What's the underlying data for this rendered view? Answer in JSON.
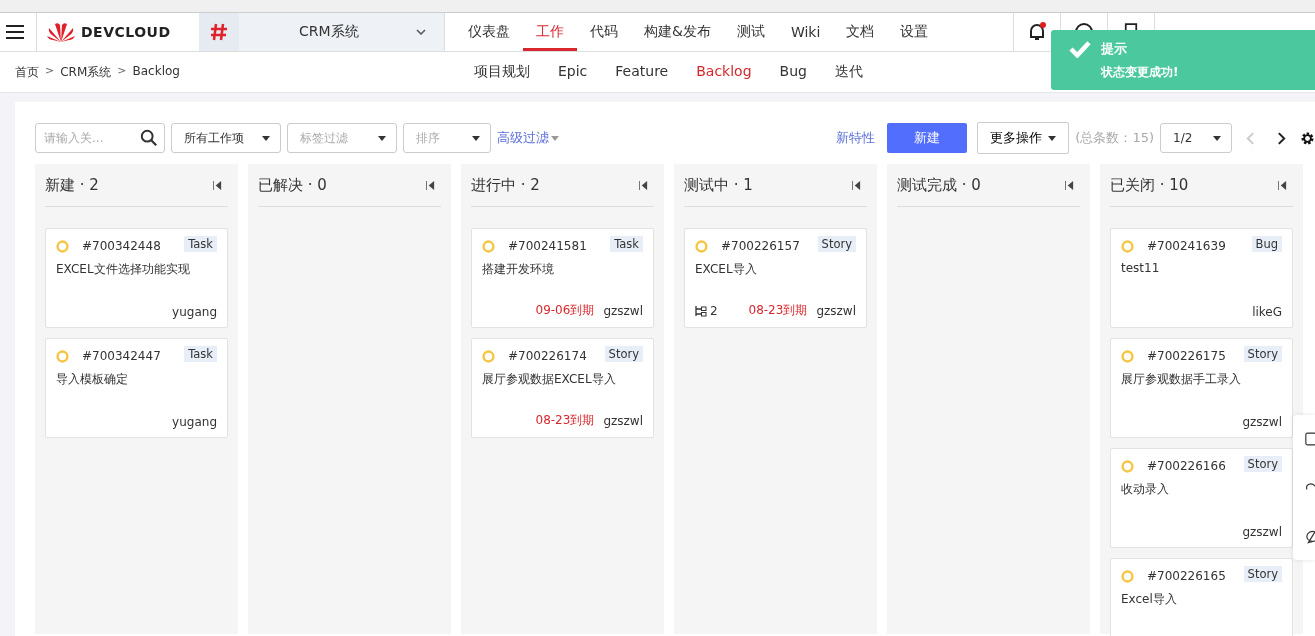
{
  "header": {
    "logo": "DEVCLOUD",
    "project": "CRM系统",
    "nav": [
      {
        "label": "仪表盘",
        "selected": false
      },
      {
        "label": "工作",
        "selected": true
      },
      {
        "label": "代码",
        "selected": false
      },
      {
        "label": "构建&发布",
        "selected": false
      },
      {
        "label": "测试",
        "selected": false
      },
      {
        "label": "Wiki",
        "selected": false
      },
      {
        "label": "文档",
        "selected": false
      },
      {
        "label": "设置",
        "selected": false
      }
    ]
  },
  "breadcrumb": [
    "首页",
    ">",
    "CRM系统",
    ">",
    "Backlog"
  ],
  "subnav": [
    {
      "label": "项目规划",
      "selected": false
    },
    {
      "label": "Epic",
      "selected": false
    },
    {
      "label": "Feature",
      "selected": false
    },
    {
      "label": "Backlog",
      "selected": true
    },
    {
      "label": "Bug",
      "selected": false
    },
    {
      "label": "迭代",
      "selected": false
    }
  ],
  "toast": {
    "title": "提示",
    "message": "状态变更成功!"
  },
  "toolbar": {
    "search": {
      "placeholder": "请输入关..."
    },
    "type_filter": "所有工作项",
    "tag_filter": {
      "placeholder": "标签过滤"
    },
    "sort": {
      "placeholder": "排序"
    },
    "advanced": "高级过滤",
    "new_feature": "新特性",
    "create": "新建",
    "more": "更多操作",
    "total": "(总条数：15)",
    "page": "1/2"
  },
  "columns": [
    {
      "title": "新建 · 2",
      "cards": [
        {
          "id": "#700342448",
          "type": "Task",
          "title": "EXCEL文件选择功能实现",
          "assignee": "yugang"
        },
        {
          "id": "#700342447",
          "type": "Task",
          "title": "导入模板确定",
          "assignee": "yugang"
        }
      ]
    },
    {
      "title": "已解决 · 0"
    },
    {
      "title": "进行中 · 2",
      "cards": [
        {
          "id": "#700241581",
          "type": "Task",
          "title": "搭建开发环境",
          "due": "09-06到期",
          "assignee": "gzszwl"
        },
        {
          "id": "#700226174",
          "type": "Story",
          "title": "展厅参观数据EXCEL导入",
          "due": "08-23到期",
          "assignee": "gzszwl"
        }
      ]
    },
    {
      "title": "测试中 · 1",
      "cards": [
        {
          "id": "#700226157",
          "type": "Story",
          "title": "EXCEL导入",
          "children": "2",
          "due": "08-23到期",
          "assignee": "gzszwl"
        }
      ]
    },
    {
      "title": "测试完成 · 0"
    },
    {
      "title": "已关闭 · 10",
      "cards": [
        {
          "id": "#700241639",
          "type": "Bug",
          "title": "test11",
          "assignee": "likeG"
        },
        {
          "id": "#700226175",
          "type": "Story",
          "title": "展厅参观数据手工录入",
          "assignee": "gzszwl"
        },
        {
          "id": "#700226166",
          "type": "Story",
          "title": "收动录入",
          "assignee": "gzszwl"
        },
        {
          "id": "#700226165",
          "type": "Story",
          "title": "Excel导入"
        }
      ]
    }
  ]
}
